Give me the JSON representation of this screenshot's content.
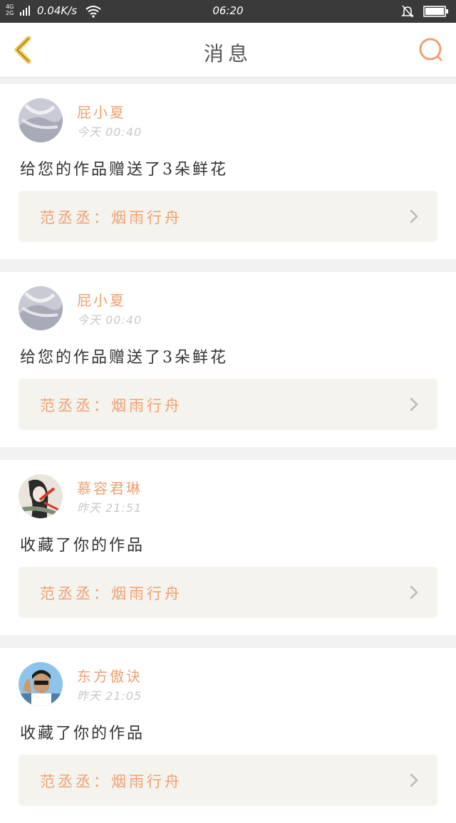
{
  "status_bar": {
    "network_top": "4G",
    "network_bottom": "2G",
    "speed": "0.04K/s",
    "time": "06:20"
  },
  "header": {
    "title": "消息"
  },
  "colors": {
    "accent": "#f0a070",
    "back_icon": "#f5c84a",
    "status_bar_bg": "#3a3a3a"
  },
  "messages": [
    {
      "name": "屁小夏",
      "time": "今天 00:40",
      "text": "给您的作品赠送了3朵鲜花",
      "work": "范丞丞：烟雨行舟"
    },
    {
      "name": "屁小夏",
      "time": "今天 00:40",
      "text": "给您的作品赠送了3朵鲜花",
      "work": "范丞丞：烟雨行舟"
    },
    {
      "name": "慕容君琳",
      "time": "昨天 21:51",
      "text": "收藏了你的作品",
      "work": "范丞丞：烟雨行舟"
    },
    {
      "name": "东方傲诀",
      "time": "昨天 21:05",
      "text": "收藏了你的作品",
      "work": "范丞丞：烟雨行舟"
    }
  ]
}
